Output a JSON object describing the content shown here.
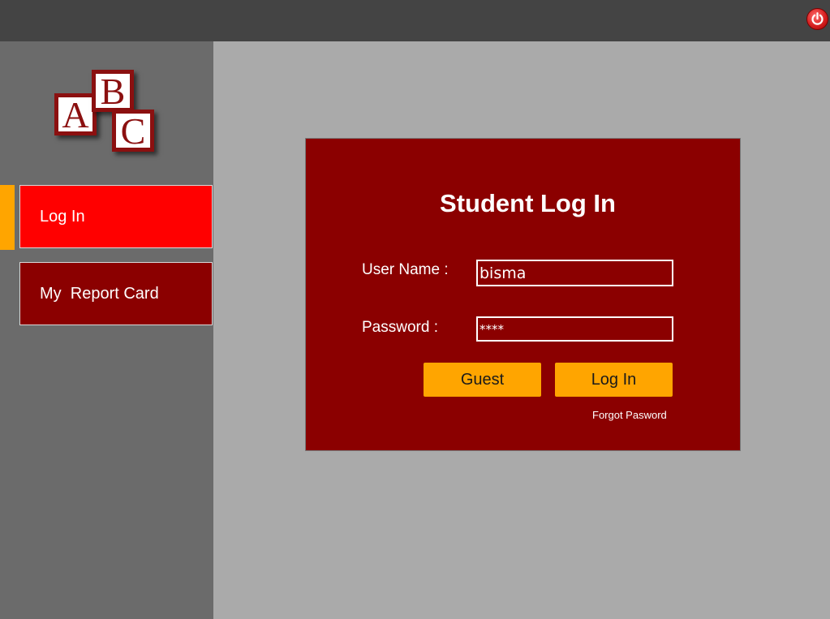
{
  "topbar": {
    "power_icon": "power-icon",
    "power_color": "#d62020"
  },
  "sidebar": {
    "logo_letters": [
      "A",
      "B",
      "C"
    ],
    "items": [
      {
        "label": "Log In",
        "active": true,
        "bg": "#ff0000"
      },
      {
        "label": "My  Report Card",
        "active": false,
        "bg": "#8b0000"
      }
    ],
    "indicator_color": "#ffa500"
  },
  "login_panel": {
    "title": "Student Log In",
    "username_label": "User Name :",
    "username_value": "bisma",
    "password_label": "Password :",
    "password_value": "****",
    "guest_button": "Guest",
    "login_button": "Log In",
    "forgot_link": "Forgot Pasword",
    "panel_color": "#8b0000",
    "button_color": "#ffa500"
  }
}
